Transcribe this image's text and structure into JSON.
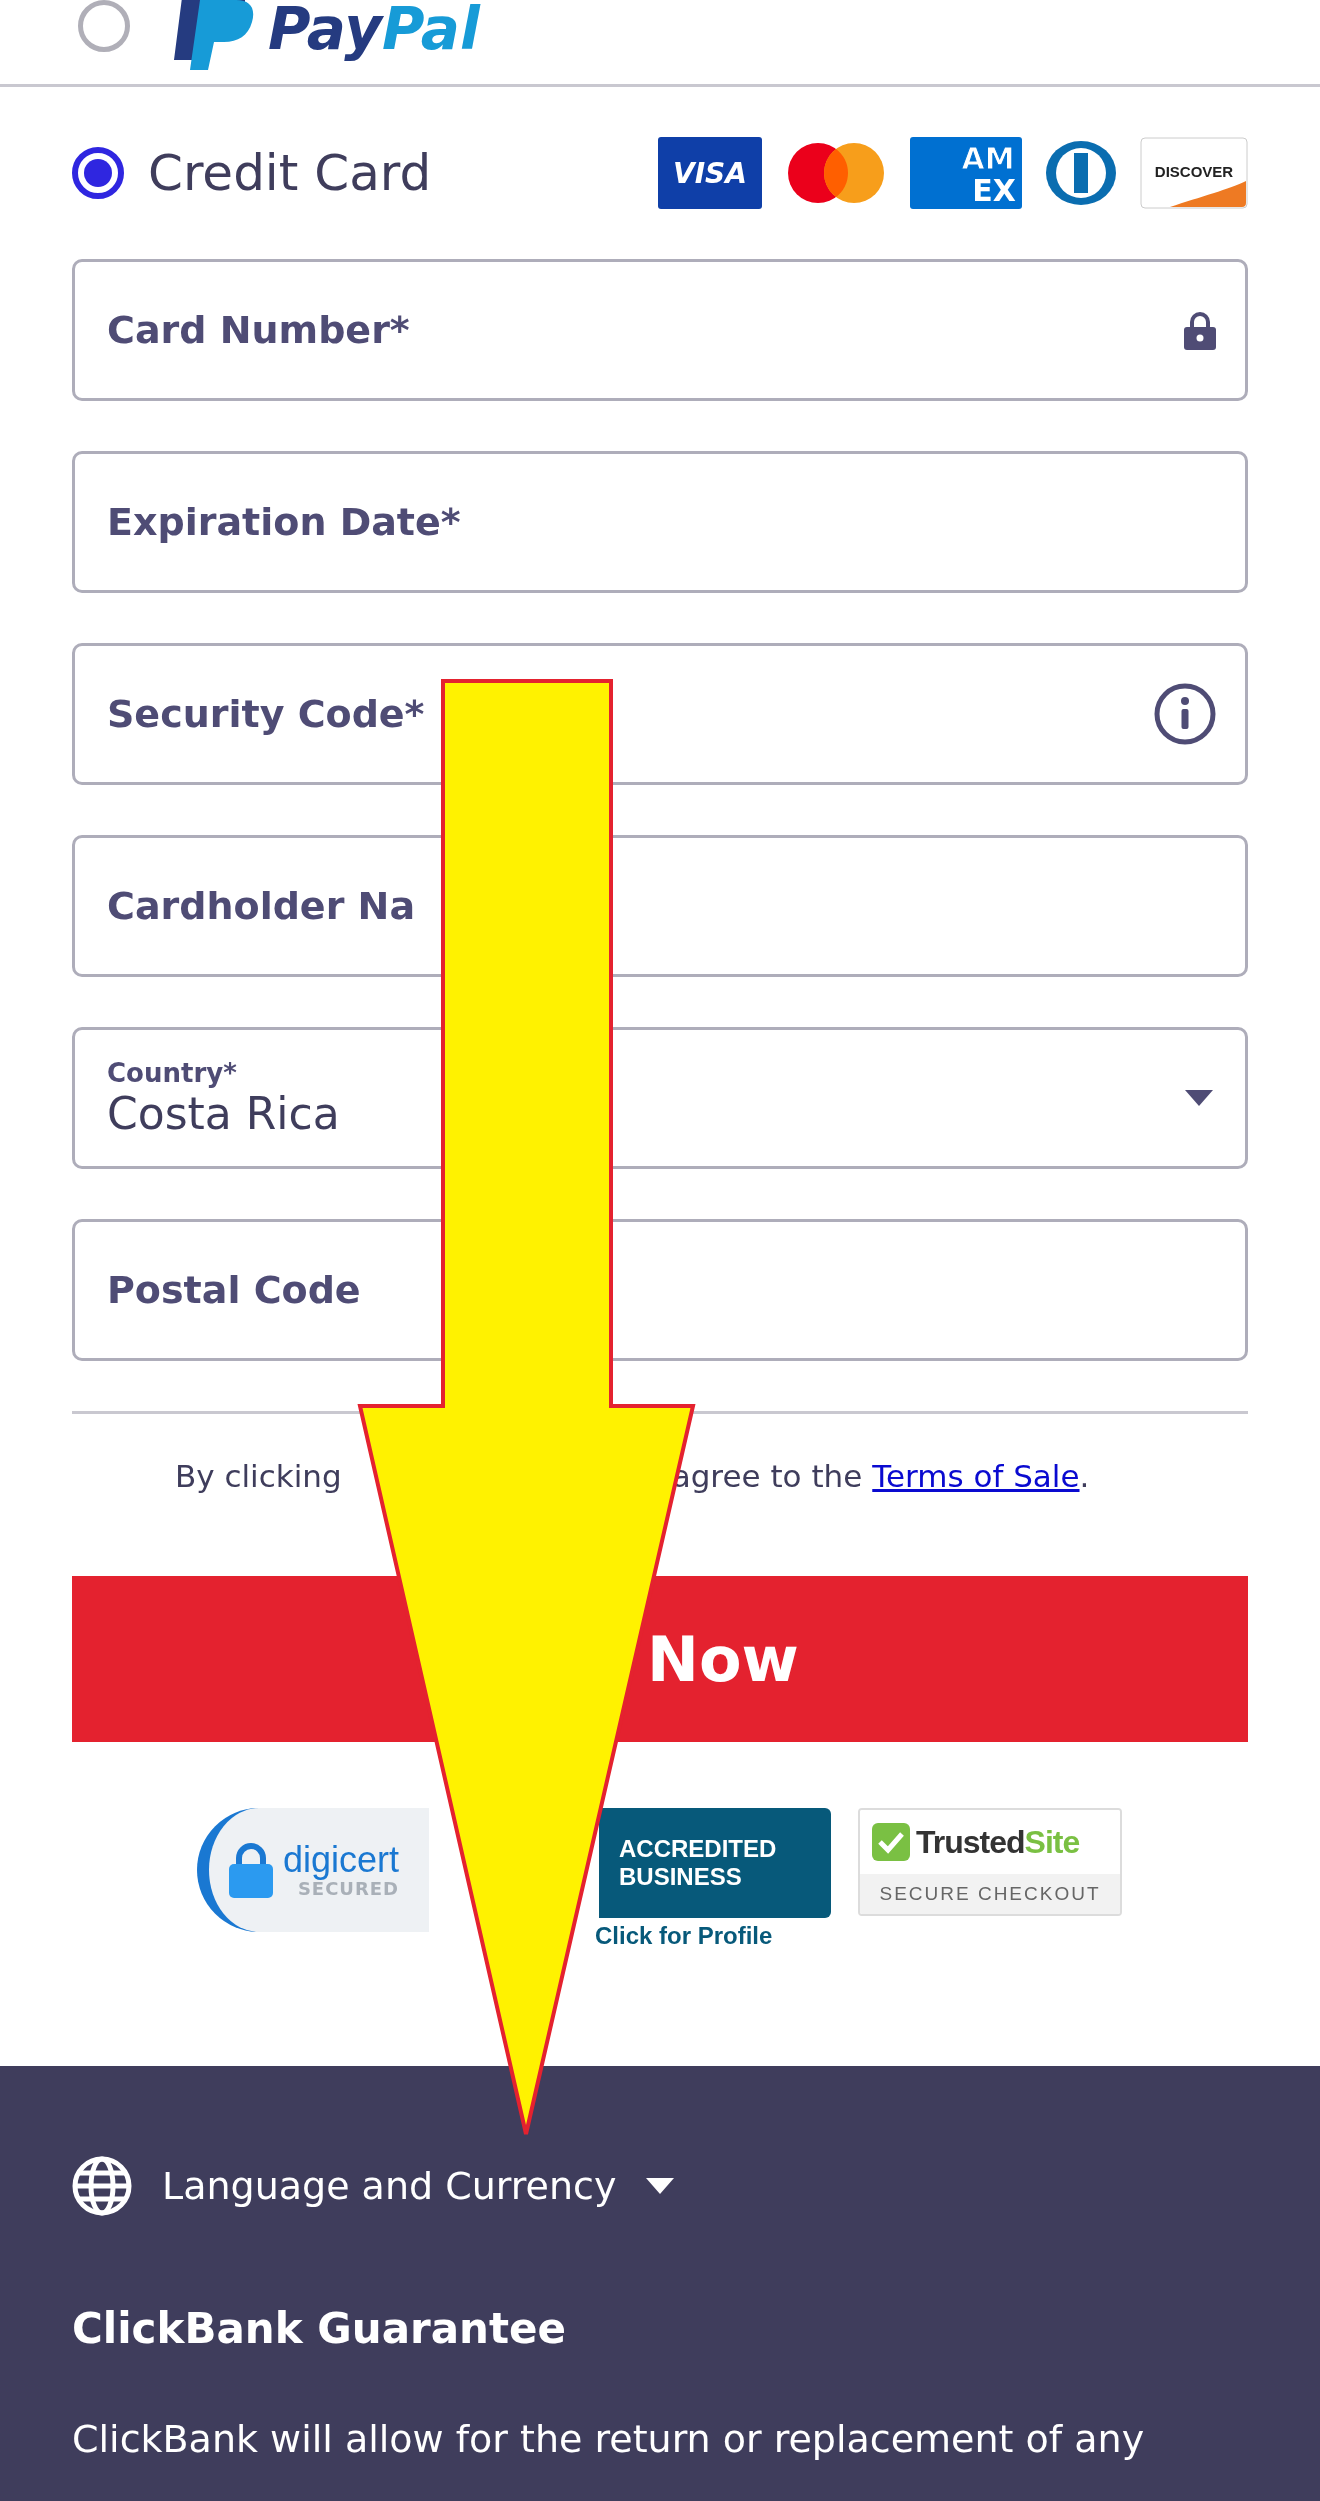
{
  "payment_methods": [
    {
      "kind": "paypal",
      "selected": false,
      "brand_1": "Pay",
      "brand_2": "Pal"
    },
    {
      "kind": "card",
      "selected": true,
      "label": "Credit Card"
    }
  ],
  "card_brands": [
    {
      "kind": "visa",
      "label": "VISA"
    },
    {
      "kind": "mastercard"
    },
    {
      "kind": "amex",
      "label": "AM",
      "label_2": "EX"
    },
    {
      "kind": "diners"
    },
    {
      "kind": "discover",
      "label": "DISCOVER"
    }
  ],
  "fields": [
    {
      "kind": "lock",
      "placeholder": "Card Number*"
    },
    {
      "kind": "plain",
      "placeholder": "Expiration Date*"
    },
    {
      "kind": "info",
      "placeholder": "Security Code*"
    },
    {
      "kind": "plain",
      "placeholder": "Cardholder Na"
    },
    {
      "kind": "select",
      "label": "Country*",
      "value": "Costa Rica"
    },
    {
      "kind": "plain",
      "placeholder": "Postal Code"
    }
  ],
  "terms": {
    "before": "By clicking",
    "after": "agree to the",
    "link": "Terms of Sale",
    "suffix": "."
  },
  "submit_button": "Now",
  "badges": {
    "digicert": {
      "name": "digicert",
      "sub": "SECURED"
    },
    "bbb": {
      "line_1": "ACCREDITED",
      "line_2": "BUSINESS",
      "caption": "Click for Profile"
    },
    "trustedsite": {
      "name_1": "Trusted",
      "name_2": "Site",
      "sub": "SECURE CHECKOUT"
    }
  },
  "footer": {
    "language_menu": "Language and Currency",
    "heading": "ClickBank Guarantee",
    "text": "ClickBank will allow for the return or replacement of any"
  }
}
